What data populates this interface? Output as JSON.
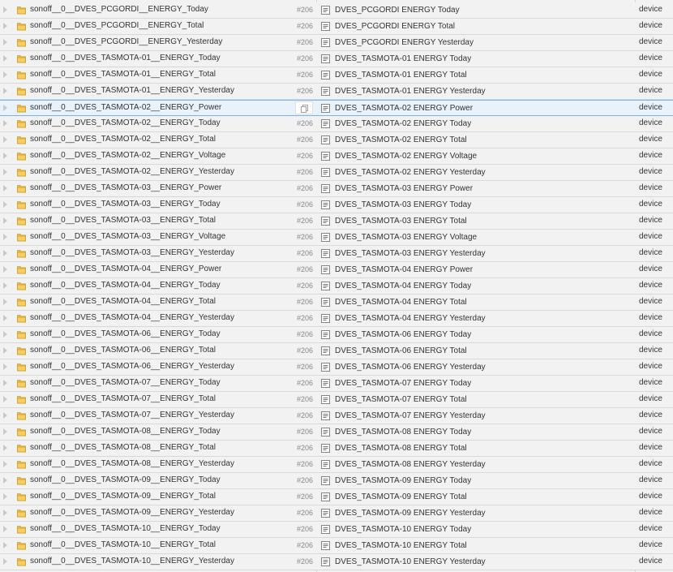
{
  "object_tree": {
    "selected_index": 6,
    "rows": [
      {
        "id": "sonoff__0__DVES_PCGORDI__ENERGY_Today",
        "count": "#206",
        "name": "DVES_PCGORDI ENERGY Today",
        "type": "device"
      },
      {
        "id": "sonoff__0__DVES_PCGORDI__ENERGY_Total",
        "count": "#206",
        "name": "DVES_PCGORDI ENERGY Total",
        "type": "device"
      },
      {
        "id": "sonoff__0__DVES_PCGORDI__ENERGY_Yesterday",
        "count": "#206",
        "name": "DVES_PCGORDI ENERGY Yesterday",
        "type": "device"
      },
      {
        "id": "sonoff__0__DVES_TASMOTA-01__ENERGY_Today",
        "count": "#206",
        "name": "DVES_TASMOTA-01 ENERGY Today",
        "type": "device"
      },
      {
        "id": "sonoff__0__DVES_TASMOTA-01__ENERGY_Total",
        "count": "#206",
        "name": "DVES_TASMOTA-01 ENERGY Total",
        "type": "device"
      },
      {
        "id": "sonoff__0__DVES_TASMOTA-01__ENERGY_Yesterday",
        "count": "#206",
        "name": "DVES_TASMOTA-01 ENERGY Yesterday",
        "type": "device"
      },
      {
        "id": "sonoff__0__DVES_TASMOTA-02__ENERGY_Power",
        "count": "",
        "name": "DVES_TASMOTA-02 ENERGY Power",
        "type": "device"
      },
      {
        "id": "sonoff__0__DVES_TASMOTA-02__ENERGY_Today",
        "count": "#206",
        "name": "DVES_TASMOTA-02 ENERGY Today",
        "type": "device"
      },
      {
        "id": "sonoff__0__DVES_TASMOTA-02__ENERGY_Total",
        "count": "#206",
        "name": "DVES_TASMOTA-02 ENERGY Total",
        "type": "device"
      },
      {
        "id": "sonoff__0__DVES_TASMOTA-02__ENERGY_Voltage",
        "count": "#206",
        "name": "DVES_TASMOTA-02 ENERGY Voltage",
        "type": "device"
      },
      {
        "id": "sonoff__0__DVES_TASMOTA-02__ENERGY_Yesterday",
        "count": "#206",
        "name": "DVES_TASMOTA-02 ENERGY Yesterday",
        "type": "device"
      },
      {
        "id": "sonoff__0__DVES_TASMOTA-03__ENERGY_Power",
        "count": "#206",
        "name": "DVES_TASMOTA-03 ENERGY Power",
        "type": "device"
      },
      {
        "id": "sonoff__0__DVES_TASMOTA-03__ENERGY_Today",
        "count": "#206",
        "name": "DVES_TASMOTA-03 ENERGY Today",
        "type": "device"
      },
      {
        "id": "sonoff__0__DVES_TASMOTA-03__ENERGY_Total",
        "count": "#206",
        "name": "DVES_TASMOTA-03 ENERGY Total",
        "type": "device"
      },
      {
        "id": "sonoff__0__DVES_TASMOTA-03__ENERGY_Voltage",
        "count": "#206",
        "name": "DVES_TASMOTA-03 ENERGY Voltage",
        "type": "device"
      },
      {
        "id": "sonoff__0__DVES_TASMOTA-03__ENERGY_Yesterday",
        "count": "#206",
        "name": "DVES_TASMOTA-03 ENERGY Yesterday",
        "type": "device"
      },
      {
        "id": "sonoff__0__DVES_TASMOTA-04__ENERGY_Power",
        "count": "#206",
        "name": "DVES_TASMOTA-04 ENERGY Power",
        "type": "device"
      },
      {
        "id": "sonoff__0__DVES_TASMOTA-04__ENERGY_Today",
        "count": "#206",
        "name": "DVES_TASMOTA-04 ENERGY Today",
        "type": "device"
      },
      {
        "id": "sonoff__0__DVES_TASMOTA-04__ENERGY_Total",
        "count": "#206",
        "name": "DVES_TASMOTA-04 ENERGY Total",
        "type": "device"
      },
      {
        "id": "sonoff__0__DVES_TASMOTA-04__ENERGY_Yesterday",
        "count": "#206",
        "name": "DVES_TASMOTA-04 ENERGY Yesterday",
        "type": "device"
      },
      {
        "id": "sonoff__0__DVES_TASMOTA-06__ENERGY_Today",
        "count": "#206",
        "name": "DVES_TASMOTA-06 ENERGY Today",
        "type": "device"
      },
      {
        "id": "sonoff__0__DVES_TASMOTA-06__ENERGY_Total",
        "count": "#206",
        "name": "DVES_TASMOTA-06 ENERGY Total",
        "type": "device"
      },
      {
        "id": "sonoff__0__DVES_TASMOTA-06__ENERGY_Yesterday",
        "count": "#206",
        "name": "DVES_TASMOTA-06 ENERGY Yesterday",
        "type": "device"
      },
      {
        "id": "sonoff__0__DVES_TASMOTA-07__ENERGY_Today",
        "count": "#206",
        "name": "DVES_TASMOTA-07 ENERGY Today",
        "type": "device"
      },
      {
        "id": "sonoff__0__DVES_TASMOTA-07__ENERGY_Total",
        "count": "#206",
        "name": "DVES_TASMOTA-07 ENERGY Total",
        "type": "device"
      },
      {
        "id": "sonoff__0__DVES_TASMOTA-07__ENERGY_Yesterday",
        "count": "#206",
        "name": "DVES_TASMOTA-07 ENERGY Yesterday",
        "type": "device"
      },
      {
        "id": "sonoff__0__DVES_TASMOTA-08__ENERGY_Today",
        "count": "#206",
        "name": "DVES_TASMOTA-08 ENERGY Today",
        "type": "device"
      },
      {
        "id": "sonoff__0__DVES_TASMOTA-08__ENERGY_Total",
        "count": "#206",
        "name": "DVES_TASMOTA-08 ENERGY Total",
        "type": "device"
      },
      {
        "id": "sonoff__0__DVES_TASMOTA-08__ENERGY_Yesterday",
        "count": "#206",
        "name": "DVES_TASMOTA-08 ENERGY Yesterday",
        "type": "device"
      },
      {
        "id": "sonoff__0__DVES_TASMOTA-09__ENERGY_Today",
        "count": "#206",
        "name": "DVES_TASMOTA-09 ENERGY Today",
        "type": "device"
      },
      {
        "id": "sonoff__0__DVES_TASMOTA-09__ENERGY_Total",
        "count": "#206",
        "name": "DVES_TASMOTA-09 ENERGY Total",
        "type": "device"
      },
      {
        "id": "sonoff__0__DVES_TASMOTA-09__ENERGY_Yesterday",
        "count": "#206",
        "name": "DVES_TASMOTA-09 ENERGY Yesterday",
        "type": "device"
      },
      {
        "id": "sonoff__0__DVES_TASMOTA-10__ENERGY_Today",
        "count": "#206",
        "name": "DVES_TASMOTA-10 ENERGY Today",
        "type": "device"
      },
      {
        "id": "sonoff__0__DVES_TASMOTA-10__ENERGY_Total",
        "count": "#206",
        "name": "DVES_TASMOTA-10 ENERGY Total",
        "type": "device"
      },
      {
        "id": "sonoff__0__DVES_TASMOTA-10__ENERGY_Yesterday",
        "count": "#206",
        "name": "DVES_TASMOTA-10 ENERGY Yesterday",
        "type": "device"
      }
    ]
  },
  "icons": {
    "folder": "folder-icon",
    "state": "state-object-icon",
    "expander": "expand-triangle-icon",
    "copy": "copy-icon"
  },
  "colors": {
    "folder_fill": "#f0c04a",
    "selection_background": "#e8f2fb",
    "selection_border": "#7fb2dd"
  }
}
